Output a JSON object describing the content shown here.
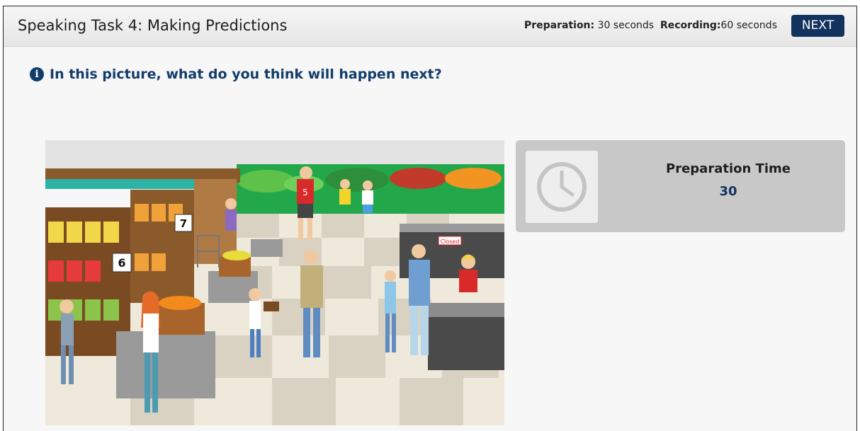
{
  "header": {
    "title": "Speaking Task 4: Making Predictions",
    "preparation_label": "Preparation:",
    "preparation_value": "30 seconds",
    "recording_label": "Recording:",
    "recording_value": "60 seconds",
    "next_label": "NEXT"
  },
  "question": {
    "icon": "info-icon",
    "text": "In this picture, what do you think will happen next?"
  },
  "scene": {
    "description_icon": "grocery-store-illustration",
    "shelf_signs": [
      "6",
      "7"
    ],
    "checkout_sign": "Closed",
    "player_number": "5"
  },
  "prep_panel": {
    "icon": "clock-icon",
    "label": "Preparation Time",
    "value": "30"
  },
  "colors": {
    "next_button": "#12335e",
    "question_text": "#123c6b",
    "panel_bg": "#c8c8c8"
  }
}
